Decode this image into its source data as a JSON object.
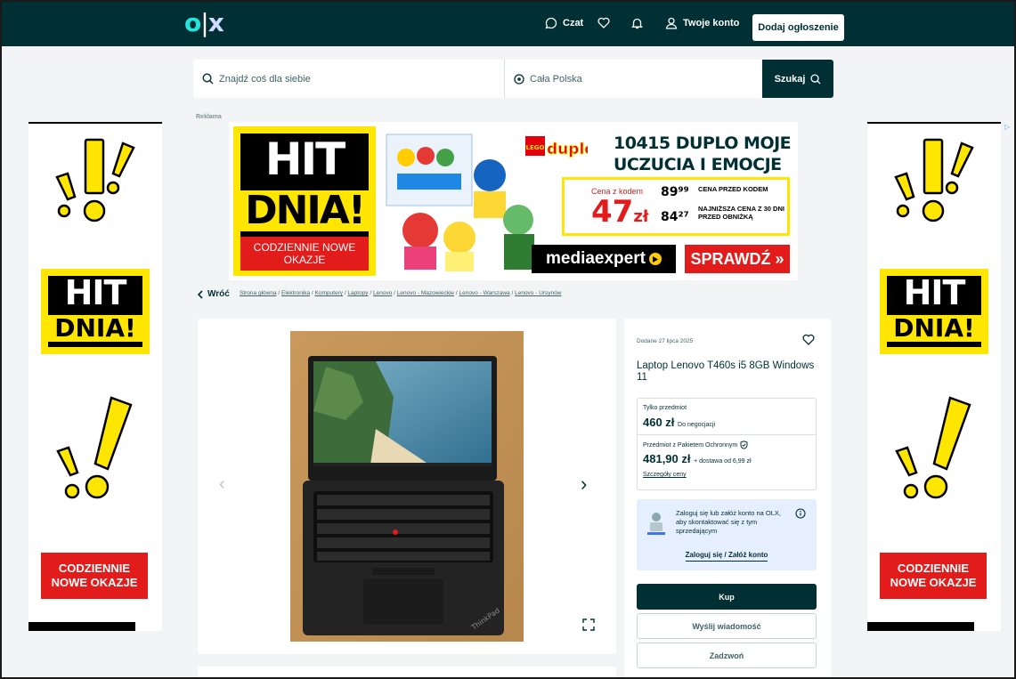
{
  "header": {
    "logo": {
      "o": "o",
      "bar": "|",
      "x": "x"
    },
    "nav": {
      "chat": "Czat",
      "account": "Twoje konto"
    },
    "add_button": "Dodaj ogłoszenie"
  },
  "search": {
    "placeholder": "Znajdź coś dla siebie",
    "location": "Cała Polska",
    "button": "Szukaj"
  },
  "ad": {
    "label": "Reklama",
    "hit_line1": "HIT",
    "hit_line2": "DNIA!",
    "daily": "CODZIENNIE NOWE OKAZJE",
    "brand_lego": "LEGO",
    "brand_duplo": "duplo",
    "product_title_1": "10415 DUPLO MOJE",
    "product_title_2": "UCZUCIA I EMOCJE",
    "code_label": "Cena z kodem",
    "code_price": "47",
    "code_currency": "zł",
    "price_before": "89⁹⁹",
    "price_before_label": "CENA PRZED KODEM",
    "lowest_price": "84²⁷",
    "lowest_label": "NAJNIŻSZA CENA Z 30 DNI PRZED OBNIŻKĄ",
    "store": "mediaexpert",
    "cta": "SPRAWDŹ »",
    "side_daily": "CODZIENNIE NOWE OKAZJE"
  },
  "breadcrumb": {
    "back": "Wróć",
    "items": [
      "Strona główna",
      "Elektronika",
      "Komputery",
      "Laptopy",
      "Lenovo",
      "Lenovo - Mazowieckie",
      "Lenovo - Warszawa",
      "Lenovo - Ursynów"
    ]
  },
  "listing": {
    "added": "Dodane 27 lipca 2025",
    "title": "Laptop Lenovo T460s i5 8GB Windows 11",
    "item_only_label": "Tylko przedmiot",
    "item_only_price": "460 zł",
    "negotiable": "Do negocjacji",
    "package_label": "Przedmiot z Pakietem Ochronnym",
    "package_price": "481,90 zł",
    "shipping": "+ dostawa od 6,99 zł",
    "details_link": "Szczegóły ceny",
    "login_prompt": "Zaloguj się lub załóż konto na OLX, aby skontaktować się z tym sprzedającym",
    "login_link": "Zaloguj się / Załóż konto",
    "buy": "Kup",
    "message": "Wyślij wiadomość",
    "call": "Zadzwoń"
  },
  "colors": {
    "header": "#002f34",
    "accent": "#23e5db",
    "ad_yellow": "#ffe600",
    "ad_red": "#e21b1b",
    "login_bg": "#e6efff"
  }
}
